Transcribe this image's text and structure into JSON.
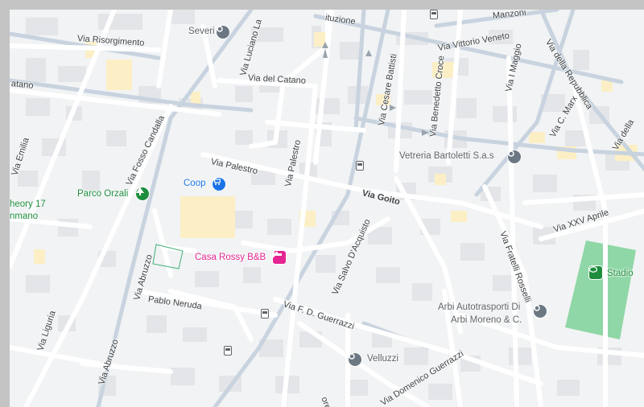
{
  "map": {
    "colors": {
      "background": "#f1f3f4",
      "road": "#ffffff",
      "major_road": "#c8d3df",
      "building": "#e3e5e8",
      "yellow_building": "#fcefc5",
      "park": "#8fd7a6",
      "grey_pin": "#6b7783",
      "shop_pin": "#1a73e8",
      "lodging_pin": "#e52592",
      "park_pin": "#1e8e3e"
    },
    "streets": {
      "risorgimento": "Via Risorgimento",
      "luciano_lama": "Via Luciano La",
      "catano_left": "atano",
      "catano": "Via del Catano",
      "emilia": "Via Emilia",
      "fosso_candalla": "Via Fosso Candalla",
      "palestro": "Via Palestro",
      "palestro2": "Via Palestro",
      "abruzzo1": "Via Abruzzo",
      "abruzzo2": "Via Abruzzo",
      "liguria": "Via Liguria",
      "pablo_neruda": "Pablo Neruda",
      "cesare_battisti": "Via Cesare Battisti",
      "benedetto_croce": "Via Benedetto Croce",
      "vittorio_veneto": "Via Vittorio Veneto",
      "manzoni": "Manzoni",
      "costituzione": "ituzione",
      "i_maggio": "Via I Maggio",
      "repubblica": "Via della Repubblica",
      "c_marx": "Via C. Marx",
      "della_right": "Via della",
      "goito": "Via Goito",
      "salvo": "Via Salvo D'Acquisto",
      "f_d_guerrazzi": "Via F. D. Guerrazzi",
      "domenico_guerrazzi": "Via Domenico Guerrazzi",
      "fratelli_rosselli": "Via Fratelli Rosselli",
      "xxv_aprile": "Via XXV Aprile",
      "ores": "ores"
    },
    "places": {
      "severi": "Severi",
      "parco_orzali": "Parco Orzali",
      "coop": "Coop",
      "casa_rossy": "Casa Rossy B&B",
      "vetreria": "Vetreria Bartoletti S.a.s",
      "arbi_line1": "Arbi Autotrasporti Di",
      "arbi_line2": "Arbi Moreno & C.",
      "stadio": "Stadio",
      "velluzzi": "Velluzzi",
      "theory_line1": "heory 17",
      "theory_line2": "nmano"
    },
    "icons": {
      "poi_grey": "map-pin-icon",
      "shop": "shopping-cart-icon",
      "lodging": "bed-icon",
      "park": "tree-icon",
      "stadium": "stadium-icon",
      "transit": "bus-stop-icon"
    }
  }
}
